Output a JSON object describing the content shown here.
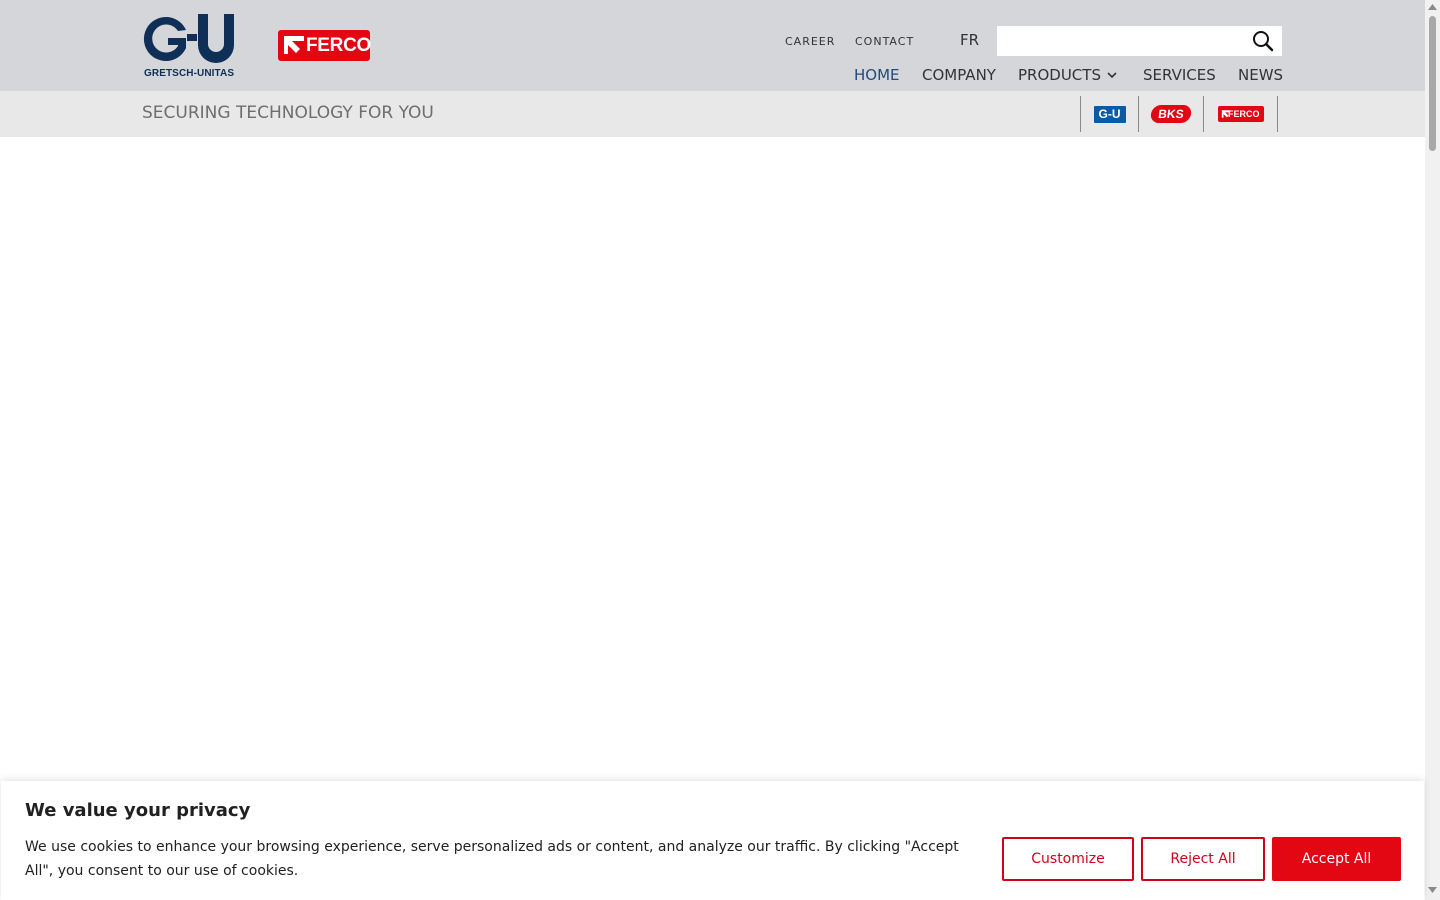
{
  "colors": {
    "header_bg": "#d4d6da",
    "subheader_bg": "#e8e8e8",
    "brand_blue": "#0f2f57",
    "brand_red": "#e30613",
    "nav_active": "#1f4a7a",
    "cookie_accent": "#d0021b"
  },
  "logos": {
    "gu_mark": "G-U",
    "gu_sub": "GRETSCH-UNITAS",
    "ferco": "FERCO"
  },
  "top_links": {
    "career": "CAREER",
    "contact": "CONTACT",
    "language": "FR"
  },
  "search": {
    "value": "",
    "placeholder": "",
    "icon": "search-icon"
  },
  "nav": {
    "home": "HOME",
    "company": "COMPANY",
    "products": "PRODUCTS",
    "services": "SERVICES",
    "news": "NEWS"
  },
  "subheader": {
    "tagline": "SECURING TECHNOLOGY FOR YOU",
    "brands": [
      "G-U",
      "BKS",
      "FERCO"
    ]
  },
  "cookie": {
    "title": "We value your privacy",
    "text": "We use cookies to enhance your browsing experience, serve personalized ads or content, and analyze our traffic. By clicking \"Accept All\", you consent to our use of cookies.",
    "customize": "Customize",
    "reject": "Reject All",
    "accept": "Accept All"
  }
}
